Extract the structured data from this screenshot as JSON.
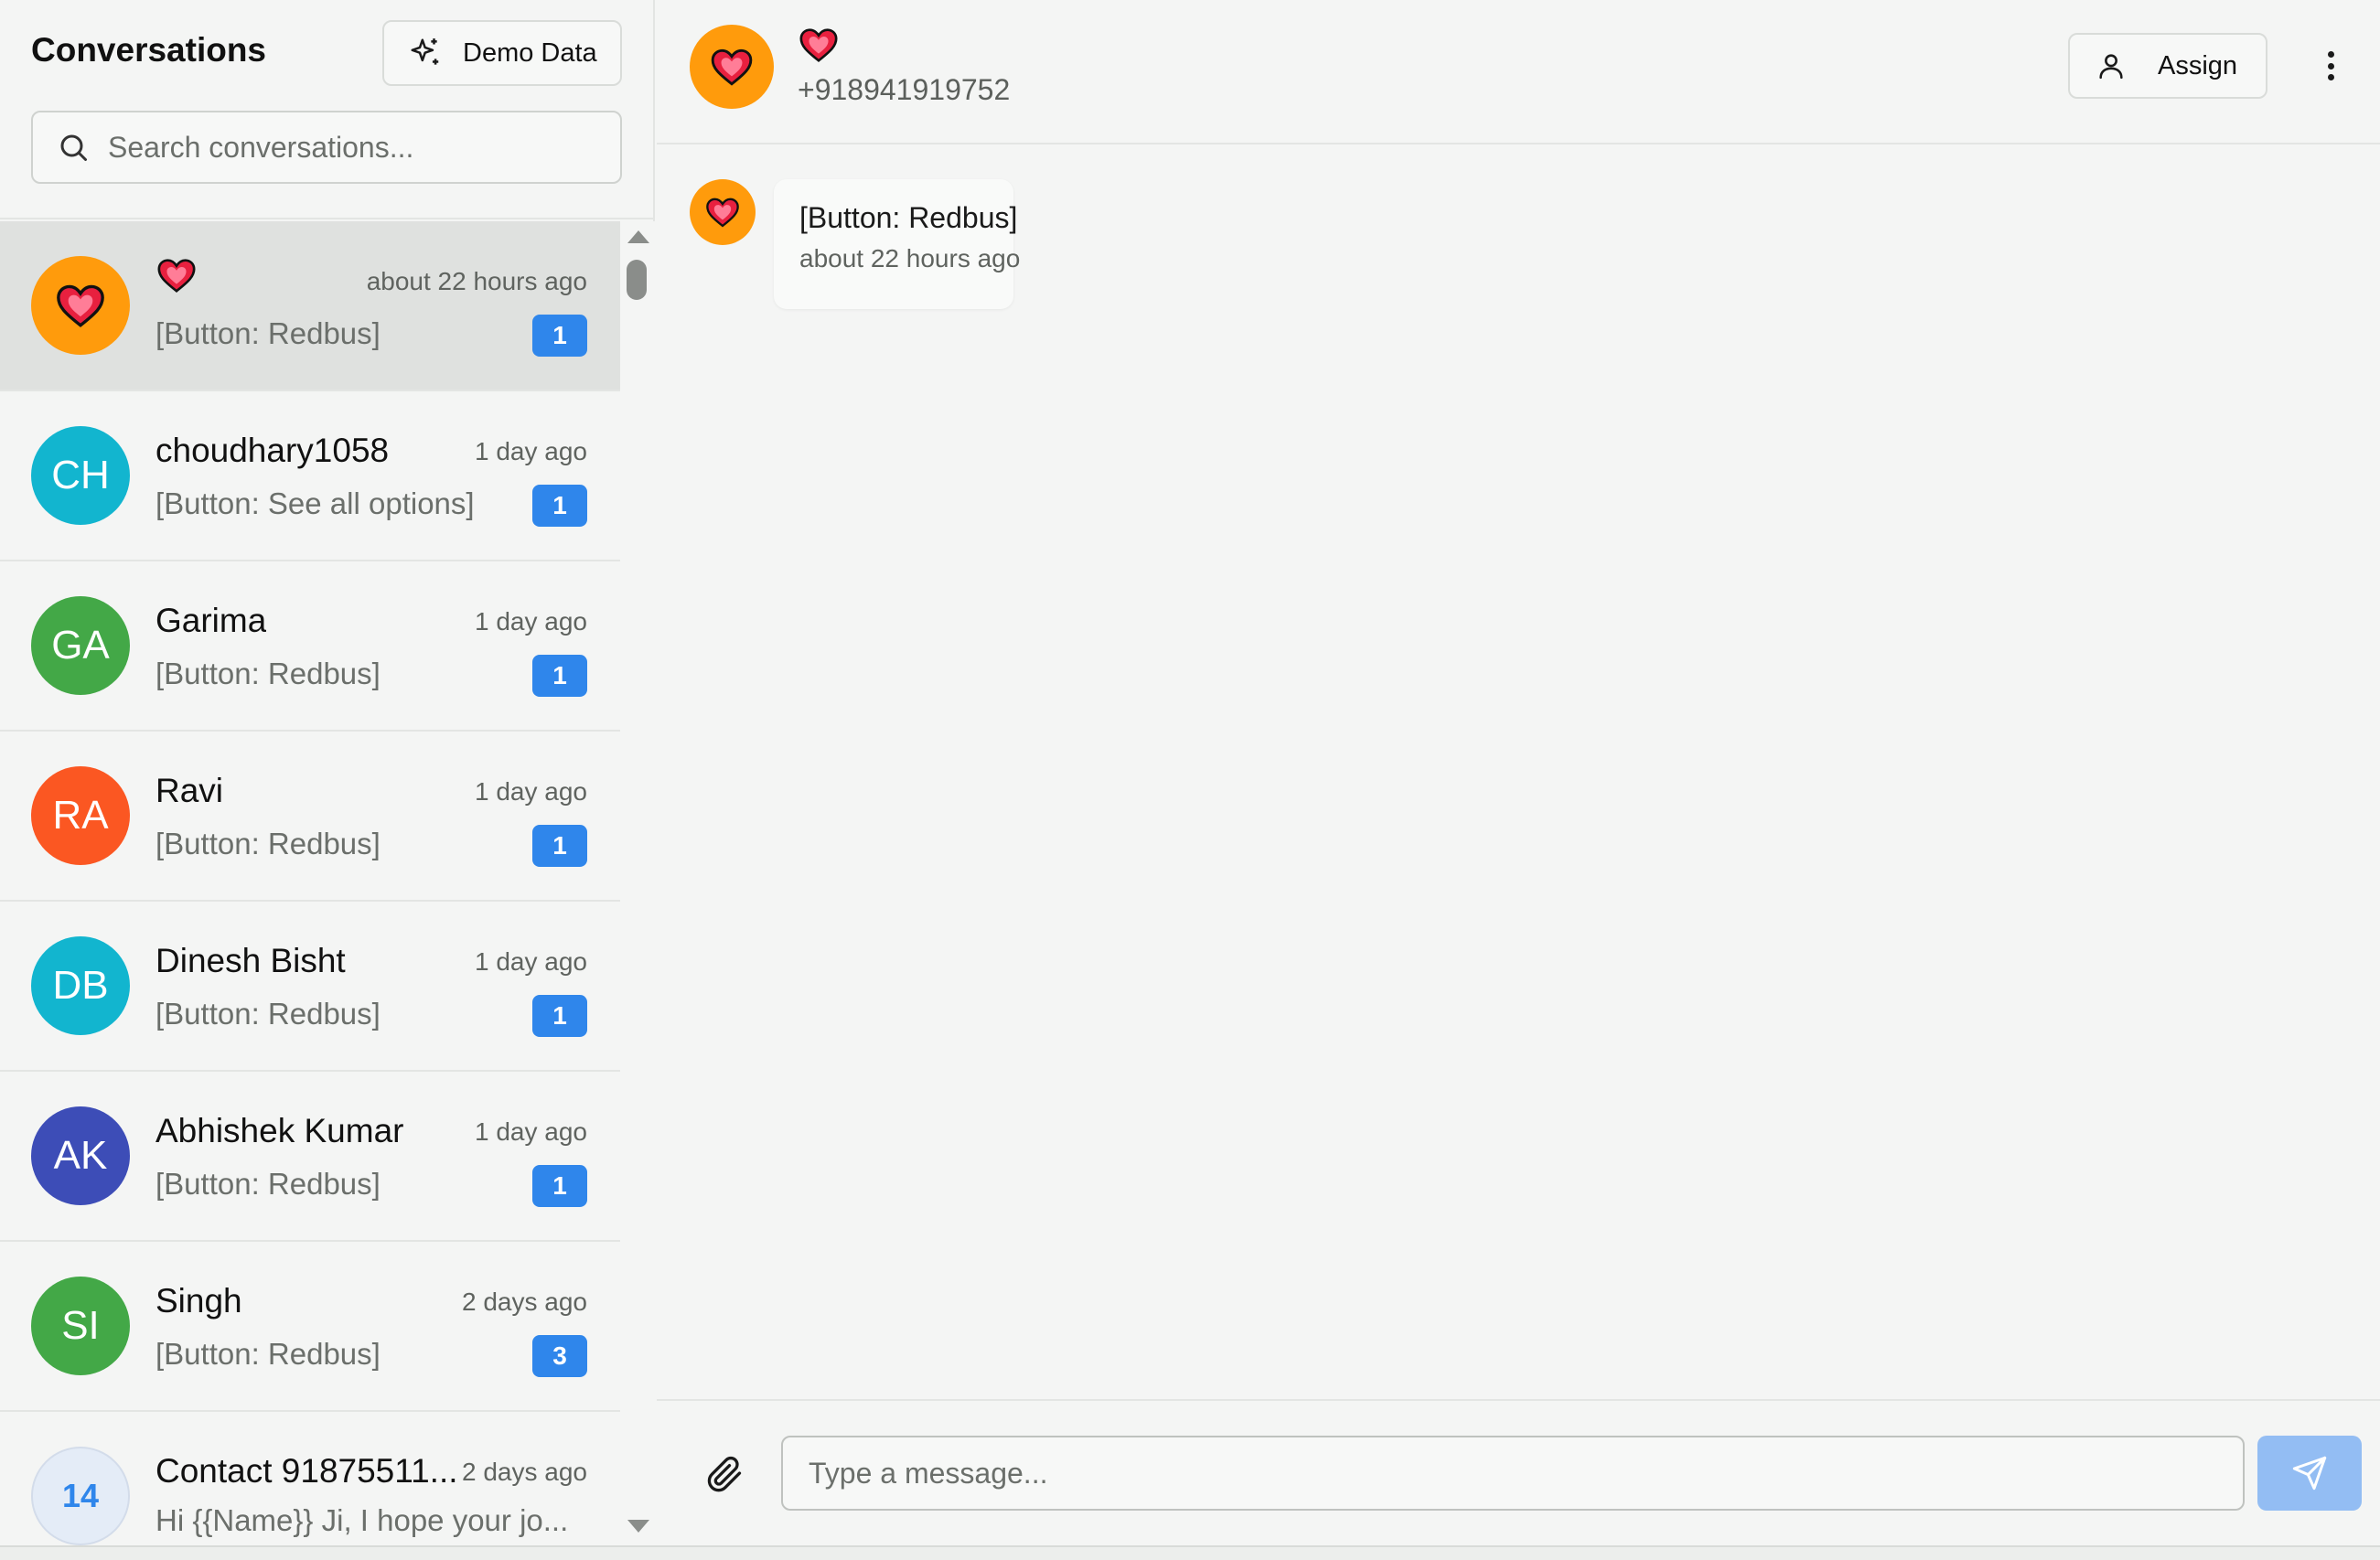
{
  "sidebar": {
    "title": "Conversations",
    "demo_button_label": "Demo Data",
    "search_placeholder": "Search conversations..."
  },
  "conversations": [
    {
      "name": "❤",
      "avatar_initials": "",
      "avatar_icon": "heart-emoji",
      "avatar_color": "#ff9b0c",
      "time": "about 22 hours ago",
      "preview": "[Button: Redbus]",
      "unread": "1",
      "active": true
    },
    {
      "name": "choudhary1058",
      "avatar_initials": "CH",
      "avatar_color": "#12b5cf",
      "time": "1 day ago",
      "preview": "[Button: See all options]",
      "unread": "1"
    },
    {
      "name": "Garima",
      "avatar_initials": "GA",
      "avatar_color": "#43a847",
      "time": "1 day ago",
      "preview": "[Button: Redbus]",
      "unread": "1"
    },
    {
      "name": "Ravi",
      "avatar_initials": "RA",
      "avatar_color": "#fb5722",
      "time": "1 day ago",
      "preview": "[Button: Redbus]",
      "unread": "1"
    },
    {
      "name": "Dinesh Bisht",
      "avatar_initials": "DB",
      "avatar_color": "#12b5cf",
      "time": "1 day ago",
      "preview": "[Button: Redbus]",
      "unread": "1"
    },
    {
      "name": "Abhishek Kumar",
      "avatar_initials": "AK",
      "avatar_color": "#3d4db7",
      "time": "1 day ago",
      "preview": "[Button: Redbus]",
      "unread": "1"
    },
    {
      "name": "Singh",
      "avatar_initials": "SI",
      "avatar_color": "#43a847",
      "time": "2 days ago",
      "preview": "[Button: Redbus]",
      "unread": "3"
    },
    {
      "name": "Contact 91875511...",
      "avatar_initials": "14",
      "avatar_color": "#e4ecf7",
      "avatar_text_color": "#2f86eb",
      "time": "2 days ago",
      "preview": "Hi {{Name}} Ji, I hope your jo...",
      "unread": ""
    }
  ],
  "chat": {
    "contact_name": "❤",
    "contact_phone": "+918941919752",
    "assign_label": "Assign",
    "messages": [
      {
        "text": "[Button: Redbus]",
        "time": "about 22 hours ago"
      }
    ],
    "input_placeholder": "Type a message..."
  },
  "colors": {
    "accent": "#2f86eb",
    "send_button": "#93bdf3",
    "contact_avatar": "#ff9b0c"
  }
}
